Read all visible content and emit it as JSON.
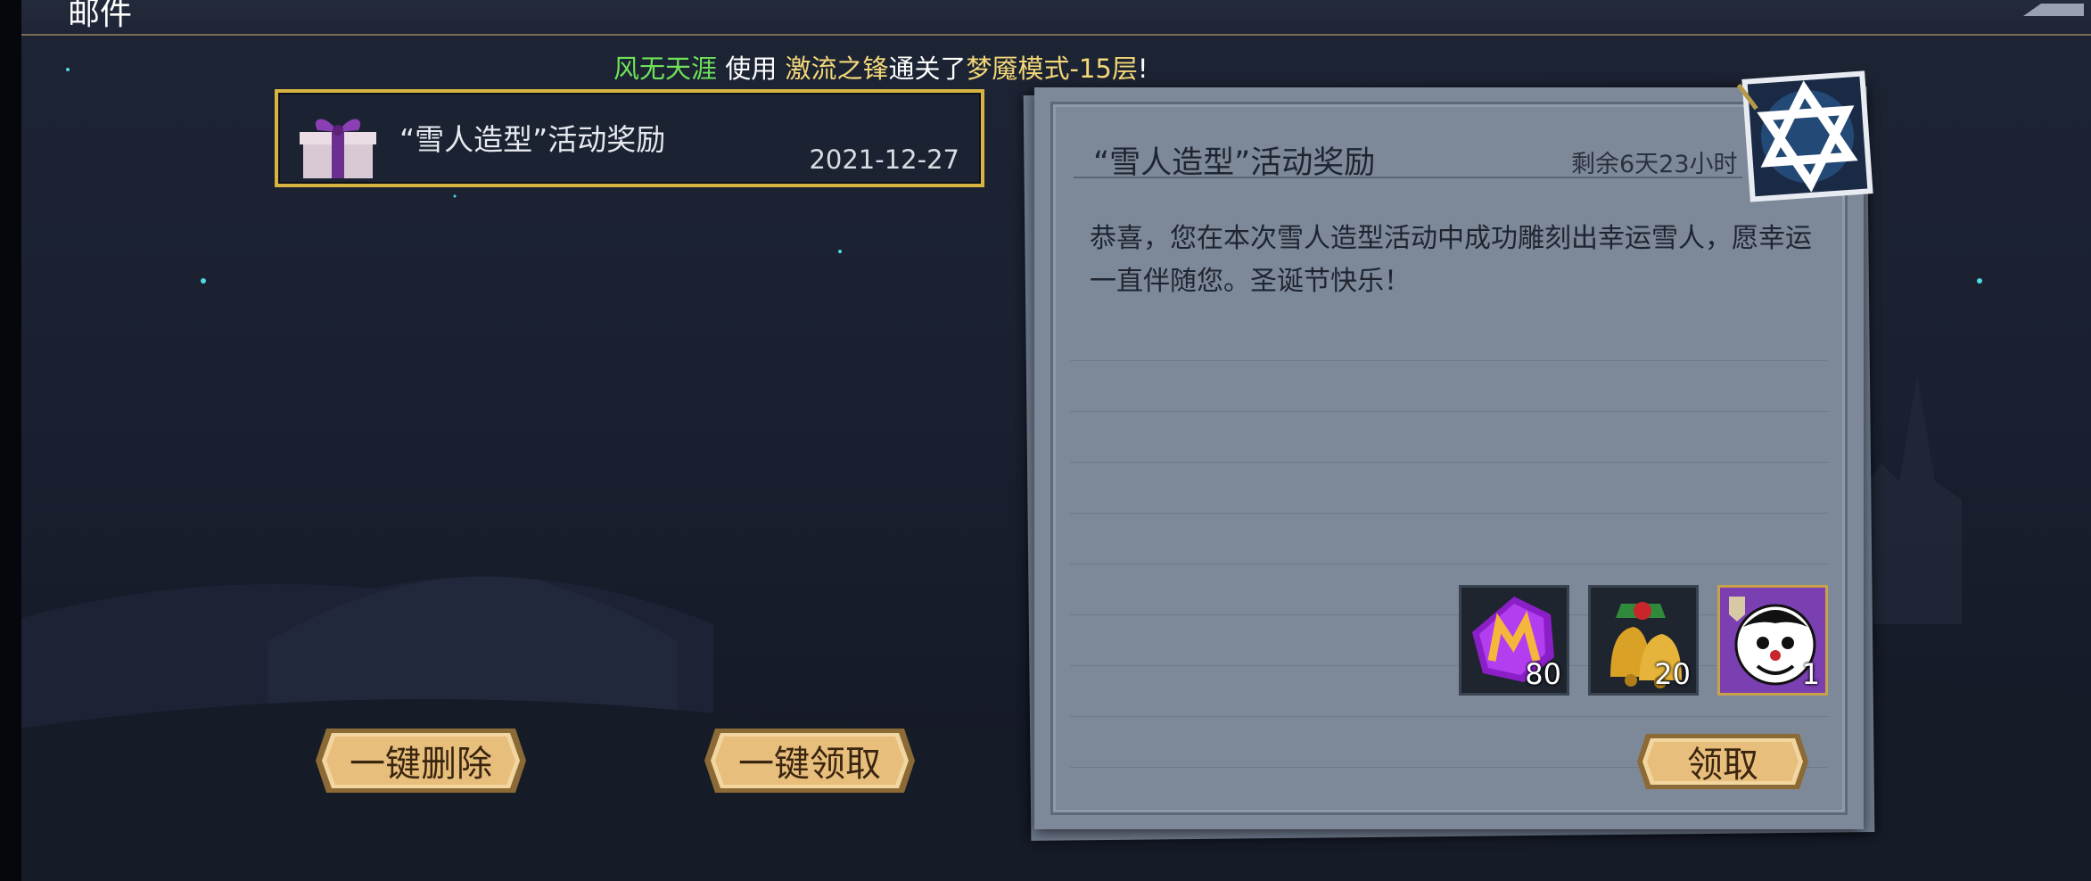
{
  "page": {
    "title": "邮件"
  },
  "broadcast": {
    "player": "风无天涯",
    "verb": "使用",
    "hero": "激流之锋",
    "action": "通关了",
    "mode": "梦魇模式-15层",
    "suffix": "!"
  },
  "mail_list": [
    {
      "title": "“雪人造型”活动奖励",
      "date": "2021-12-27",
      "selected": true,
      "icon": "gift-box-icon"
    }
  ],
  "buttons": {
    "delete_all": "一键删除",
    "claim_all": "一键领取",
    "claim": "领取"
  },
  "letter": {
    "title": "“雪人造型”活动奖励",
    "remaining": "剩余6天23小时",
    "body": "恭喜，您在本次雪人造型活动中成功雕刻出幸运雪人，愿幸运一直伴随您。圣诞节快乐！"
  },
  "rewards": [
    {
      "icon": "purple-m-gem-icon",
      "count": "80"
    },
    {
      "icon": "christmas-bells-icon",
      "count": "20"
    },
    {
      "icon": "clown-avatar-icon",
      "count": "1"
    }
  ],
  "colors": {
    "accent_gold": "#d8b542",
    "broadcast_green": "#6ee25a",
    "broadcast_gold": "#f3d778"
  }
}
